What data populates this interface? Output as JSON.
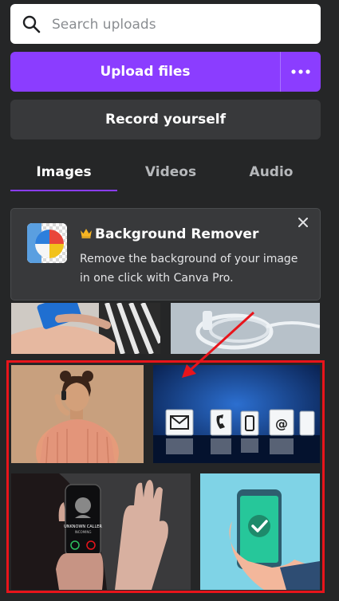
{
  "search": {
    "placeholder": "Search uploads"
  },
  "actions": {
    "upload_label": "Upload files",
    "record_label": "Record yourself"
  },
  "tabs": [
    {
      "label": "Images",
      "active": true
    },
    {
      "label": "Videos",
      "active": false
    },
    {
      "label": "Audio",
      "active": false
    }
  ],
  "promo": {
    "title": "Background Remover",
    "description": "Remove the background of your image in one click with Canva Pro.",
    "icon": "crown-icon"
  },
  "colors": {
    "accent": "#8b3dff",
    "highlight": "#e8141b",
    "background": "#252627"
  },
  "incoming_call": {
    "caller": "UNKNOWN CALLER",
    "status": "INCOMING"
  }
}
